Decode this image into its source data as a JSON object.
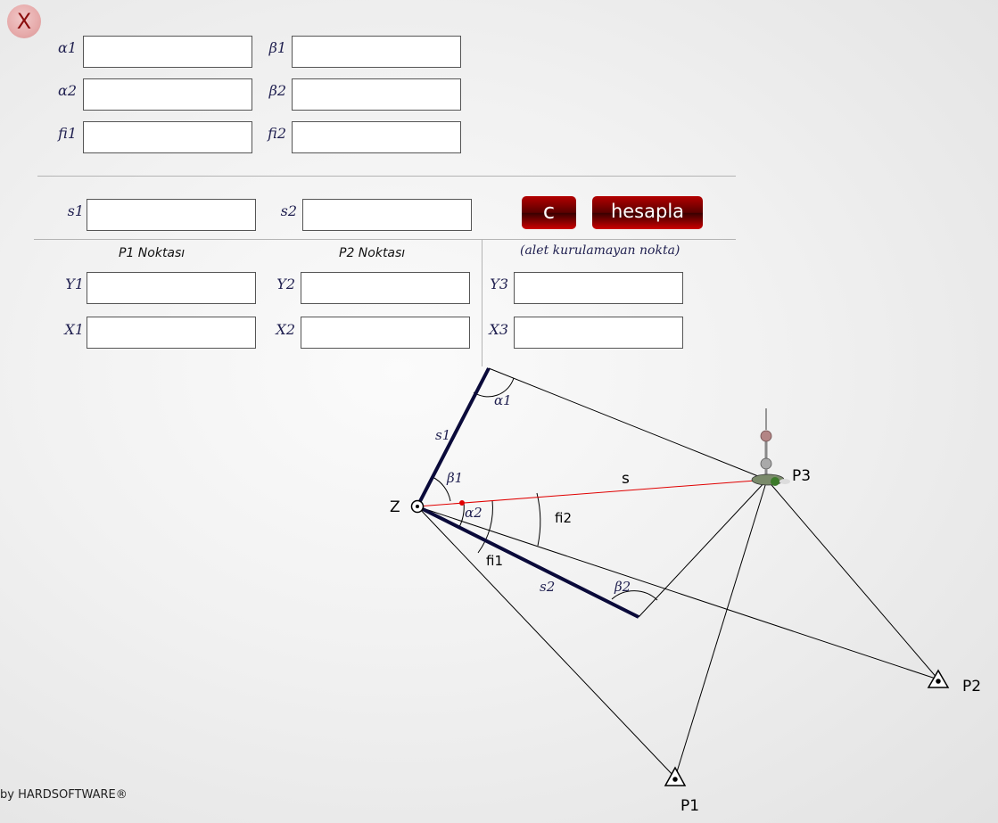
{
  "close_button": {
    "label": "X"
  },
  "angles": {
    "alpha1_label": "α1",
    "beta1_label": "β1",
    "alpha2_label": "α2",
    "beta2_label": "β2",
    "fi1_label": "fi1",
    "fi2_label": "fi2",
    "alpha1_value": "",
    "beta1_value": "",
    "alpha2_value": "",
    "beta2_value": "",
    "fi1_value": "",
    "fi2_value": ""
  },
  "distances": {
    "s1_label": "s1",
    "s2_label": "s2",
    "s1_value": "",
    "s2_value": ""
  },
  "buttons": {
    "clear_label": "c",
    "calculate_label": "hesapla"
  },
  "points": {
    "p1_heading": "P1 Noktası",
    "p2_heading": "P2 Noktası",
    "p3_heading": "(alet kurulamayan nokta)",
    "y1_label": "Y1",
    "x1_label": "X1",
    "y2_label": "Y2",
    "x2_label": "X2",
    "y3_label": "Y3",
    "x3_label": "X3",
    "y1_value": "",
    "x1_value": "",
    "y2_value": "",
    "x2_value": "",
    "y3_value": "",
    "x3_value": ""
  },
  "diagram": {
    "z_label": "Z",
    "p1_label": "P1",
    "p2_label": "P2",
    "p3_label": "P3",
    "s_label": "s",
    "s1_label": "s1",
    "s2_label": "s2",
    "alpha1_label": "α1",
    "beta1_label": "β1",
    "alpha2_label": "α2",
    "beta2_label": "β2",
    "fi1_label": "fi1",
    "fi2_label": "fi2",
    "s_line_color": "#e00000",
    "baseline_color": "#0a0a3a",
    "tower_icon": "tower-icon",
    "station_icon": "station-circle-icon",
    "triangle_icon": "triangle-benchmark-icon"
  },
  "footer": {
    "credit": "by HARDSOFTWARE®"
  }
}
